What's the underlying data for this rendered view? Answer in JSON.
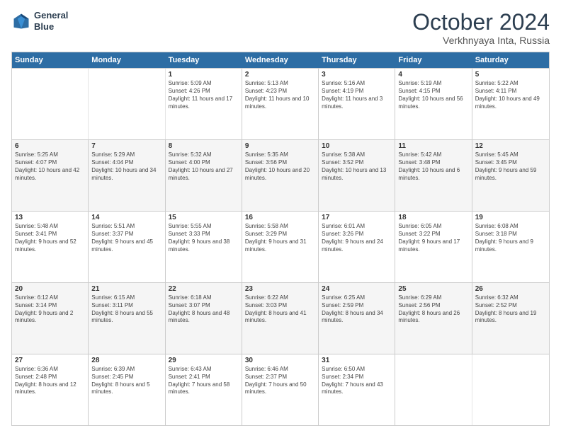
{
  "logo": {
    "line1": "General",
    "line2": "Blue"
  },
  "title": "October 2024",
  "subtitle": "Verkhnyaya Inta, Russia",
  "headers": [
    "Sunday",
    "Monday",
    "Tuesday",
    "Wednesday",
    "Thursday",
    "Friday",
    "Saturday"
  ],
  "weeks": [
    [
      {
        "day": "",
        "sunrise": "",
        "sunset": "",
        "daylight": ""
      },
      {
        "day": "",
        "sunrise": "",
        "sunset": "",
        "daylight": ""
      },
      {
        "day": "1",
        "sunrise": "Sunrise: 5:09 AM",
        "sunset": "Sunset: 4:26 PM",
        "daylight": "Daylight: 11 hours and 17 minutes."
      },
      {
        "day": "2",
        "sunrise": "Sunrise: 5:13 AM",
        "sunset": "Sunset: 4:23 PM",
        "daylight": "Daylight: 11 hours and 10 minutes."
      },
      {
        "day": "3",
        "sunrise": "Sunrise: 5:16 AM",
        "sunset": "Sunset: 4:19 PM",
        "daylight": "Daylight: 11 hours and 3 minutes."
      },
      {
        "day": "4",
        "sunrise": "Sunrise: 5:19 AM",
        "sunset": "Sunset: 4:15 PM",
        "daylight": "Daylight: 10 hours and 56 minutes."
      },
      {
        "day": "5",
        "sunrise": "Sunrise: 5:22 AM",
        "sunset": "Sunset: 4:11 PM",
        "daylight": "Daylight: 10 hours and 49 minutes."
      }
    ],
    [
      {
        "day": "6",
        "sunrise": "Sunrise: 5:25 AM",
        "sunset": "Sunset: 4:07 PM",
        "daylight": "Daylight: 10 hours and 42 minutes."
      },
      {
        "day": "7",
        "sunrise": "Sunrise: 5:29 AM",
        "sunset": "Sunset: 4:04 PM",
        "daylight": "Daylight: 10 hours and 34 minutes."
      },
      {
        "day": "8",
        "sunrise": "Sunrise: 5:32 AM",
        "sunset": "Sunset: 4:00 PM",
        "daylight": "Daylight: 10 hours and 27 minutes."
      },
      {
        "day": "9",
        "sunrise": "Sunrise: 5:35 AM",
        "sunset": "Sunset: 3:56 PM",
        "daylight": "Daylight: 10 hours and 20 minutes."
      },
      {
        "day": "10",
        "sunrise": "Sunrise: 5:38 AM",
        "sunset": "Sunset: 3:52 PM",
        "daylight": "Daylight: 10 hours and 13 minutes."
      },
      {
        "day": "11",
        "sunrise": "Sunrise: 5:42 AM",
        "sunset": "Sunset: 3:48 PM",
        "daylight": "Daylight: 10 hours and 6 minutes."
      },
      {
        "day": "12",
        "sunrise": "Sunrise: 5:45 AM",
        "sunset": "Sunset: 3:45 PM",
        "daylight": "Daylight: 9 hours and 59 minutes."
      }
    ],
    [
      {
        "day": "13",
        "sunrise": "Sunrise: 5:48 AM",
        "sunset": "Sunset: 3:41 PM",
        "daylight": "Daylight: 9 hours and 52 minutes."
      },
      {
        "day": "14",
        "sunrise": "Sunrise: 5:51 AM",
        "sunset": "Sunset: 3:37 PM",
        "daylight": "Daylight: 9 hours and 45 minutes."
      },
      {
        "day": "15",
        "sunrise": "Sunrise: 5:55 AM",
        "sunset": "Sunset: 3:33 PM",
        "daylight": "Daylight: 9 hours and 38 minutes."
      },
      {
        "day": "16",
        "sunrise": "Sunrise: 5:58 AM",
        "sunset": "Sunset: 3:29 PM",
        "daylight": "Daylight: 9 hours and 31 minutes."
      },
      {
        "day": "17",
        "sunrise": "Sunrise: 6:01 AM",
        "sunset": "Sunset: 3:26 PM",
        "daylight": "Daylight: 9 hours and 24 minutes."
      },
      {
        "day": "18",
        "sunrise": "Sunrise: 6:05 AM",
        "sunset": "Sunset: 3:22 PM",
        "daylight": "Daylight: 9 hours and 17 minutes."
      },
      {
        "day": "19",
        "sunrise": "Sunrise: 6:08 AM",
        "sunset": "Sunset: 3:18 PM",
        "daylight": "Daylight: 9 hours and 9 minutes."
      }
    ],
    [
      {
        "day": "20",
        "sunrise": "Sunrise: 6:12 AM",
        "sunset": "Sunset: 3:14 PM",
        "daylight": "Daylight: 9 hours and 2 minutes."
      },
      {
        "day": "21",
        "sunrise": "Sunrise: 6:15 AM",
        "sunset": "Sunset: 3:11 PM",
        "daylight": "Daylight: 8 hours and 55 minutes."
      },
      {
        "day": "22",
        "sunrise": "Sunrise: 6:18 AM",
        "sunset": "Sunset: 3:07 PM",
        "daylight": "Daylight: 8 hours and 48 minutes."
      },
      {
        "day": "23",
        "sunrise": "Sunrise: 6:22 AM",
        "sunset": "Sunset: 3:03 PM",
        "daylight": "Daylight: 8 hours and 41 minutes."
      },
      {
        "day": "24",
        "sunrise": "Sunrise: 6:25 AM",
        "sunset": "Sunset: 2:59 PM",
        "daylight": "Daylight: 8 hours and 34 minutes."
      },
      {
        "day": "25",
        "sunrise": "Sunrise: 6:29 AM",
        "sunset": "Sunset: 2:56 PM",
        "daylight": "Daylight: 8 hours and 26 minutes."
      },
      {
        "day": "26",
        "sunrise": "Sunrise: 6:32 AM",
        "sunset": "Sunset: 2:52 PM",
        "daylight": "Daylight: 8 hours and 19 minutes."
      }
    ],
    [
      {
        "day": "27",
        "sunrise": "Sunrise: 6:36 AM",
        "sunset": "Sunset: 2:48 PM",
        "daylight": "Daylight: 8 hours and 12 minutes."
      },
      {
        "day": "28",
        "sunrise": "Sunrise: 6:39 AM",
        "sunset": "Sunset: 2:45 PM",
        "daylight": "Daylight: 8 hours and 5 minutes."
      },
      {
        "day": "29",
        "sunrise": "Sunrise: 6:43 AM",
        "sunset": "Sunset: 2:41 PM",
        "daylight": "Daylight: 7 hours and 58 minutes."
      },
      {
        "day": "30",
        "sunrise": "Sunrise: 6:46 AM",
        "sunset": "Sunset: 2:37 PM",
        "daylight": "Daylight: 7 hours and 50 minutes."
      },
      {
        "day": "31",
        "sunrise": "Sunrise: 6:50 AM",
        "sunset": "Sunset: 2:34 PM",
        "daylight": "Daylight: 7 hours and 43 minutes."
      },
      {
        "day": "",
        "sunrise": "",
        "sunset": "",
        "daylight": ""
      },
      {
        "day": "",
        "sunrise": "",
        "sunset": "",
        "daylight": ""
      }
    ]
  ]
}
